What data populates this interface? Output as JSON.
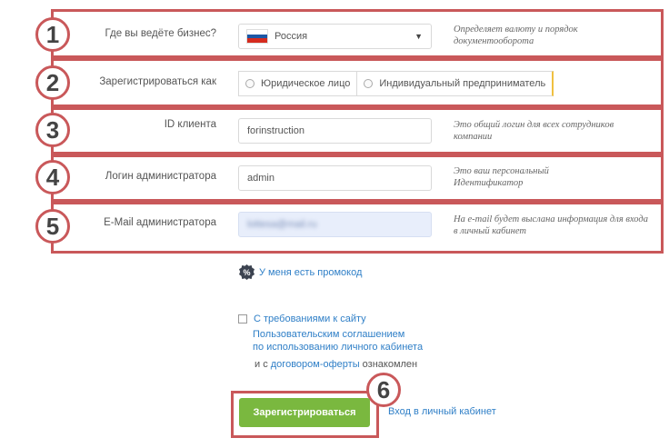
{
  "rows": [
    {
      "num": "1",
      "label": "Где вы ведёте бизнес?",
      "hint": "Определяет валюту и порядок документооборота"
    },
    {
      "num": "2",
      "label": "Зарегистрироваться как",
      "hint": ""
    },
    {
      "num": "3",
      "label": "ID клиента",
      "hint": "Это общий логин для всех сотрудников компании"
    },
    {
      "num": "4",
      "label": "Логин администратора",
      "hint": "Это ваш персональный Идентификатор"
    },
    {
      "num": "5",
      "label": "E-Mail администратора",
      "hint": "На e-mail будет выслана информация для входа в личный кабинет"
    }
  ],
  "country": {
    "value": "Россия"
  },
  "register_as": {
    "options": [
      "Юридическое лицо",
      "Индивидуальный предприниматель"
    ]
  },
  "client_id": {
    "value": "forinstruction"
  },
  "admin_login": {
    "value": "admin"
  },
  "admin_email": {
    "value": "lottesa@mail.ru"
  },
  "promo": {
    "label": "У меня есть промокод"
  },
  "terms": {
    "checkbox_label": "С требованиями к сайту",
    "agreement_link_line1": "Пользовательским соглашением",
    "agreement_link_line2": "по использованию личного кабинета",
    "and_with": "и с",
    "offer_link": "договором-оферты",
    "acquainted": "ознакомлен"
  },
  "actions": {
    "register_label": "Зарегистрироваться",
    "login_link": "Вход в личный кабинет",
    "badge": "6"
  },
  "colors": {
    "annotation": "#c9585a",
    "accent_green": "#7ab83f",
    "link_blue": "#2f7fc7",
    "flag": [
      "#ffffff",
      "#1c57a5",
      "#d52b1e"
    ]
  }
}
